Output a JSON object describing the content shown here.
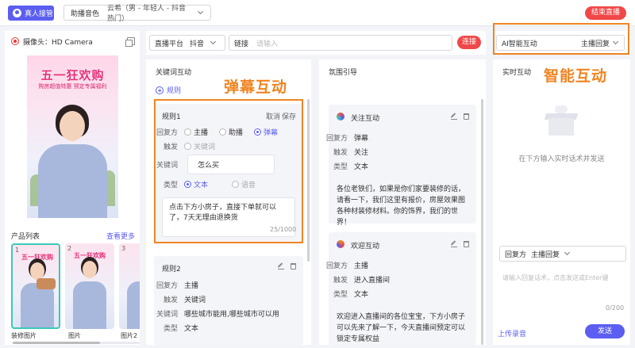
{
  "topbar": {
    "host_button": "真人接管",
    "voice_label": "助播音色",
    "voice_value": "云希（男 - 年轻人 - 抖音热门）",
    "end_button": "结束直播"
  },
  "left": {
    "camera_label": "摄像头：HD Camera",
    "video_banner": "五一狂欢购",
    "video_subbanner": "购房超值特惠 预定专属福利",
    "products_title": "产品列表",
    "products_more": "查看更多",
    "thumbs": [
      {
        "num": "1",
        "title": "五一狂欢购",
        "label": "装修图片"
      },
      {
        "num": "2",
        "title": "五一狂欢购",
        "label": "图片"
      },
      {
        "num": "3",
        "title": "五",
        "label": "图片2"
      }
    ]
  },
  "platform": {
    "label": "直播平台",
    "value": "抖音",
    "link_label": "链接",
    "link_placeholder": "请输入",
    "connect": "连接"
  },
  "keyword": {
    "title": "关键词互动",
    "add_rule": "规则",
    "overlay": "弹幕互动",
    "rule1": {
      "name": "规则1",
      "cancel": "取消",
      "save": "保存",
      "reply_label": "回复方",
      "opt1": "主播",
      "opt2": "助播",
      "opt3": "弹幕",
      "trigger_label": "触发",
      "trigger_value": "关键词",
      "kw_label": "关键词",
      "kw_value": "怎么买",
      "type_label": "类型",
      "type_text": "文本",
      "type_voice": "语音",
      "reply_text": "点击下方小房子，直接下单就可以了，7天无理由退换货",
      "counter": "25/1000"
    },
    "rule2": {
      "name": "规则2",
      "reply_label": "回复方",
      "reply_value": "主播",
      "trigger_label": "触发",
      "trigger_value": "关键词",
      "kw_label": "关键词",
      "kw_value": "哪些城市能用,哪些城市可以用",
      "type_label": "类型",
      "type_value": "文本"
    }
  },
  "atmos": {
    "title": "氛围引导",
    "card1": {
      "name": "关注互动",
      "reply_label": "回复方",
      "reply_value": "弹幕",
      "trigger_label": "触发",
      "trigger_value": "关注",
      "type_label": "类型",
      "type_value": "文本",
      "text": "各位老铁们，如果是你们家要装修的话，请看一下，我们这里有报价，房屋效果图各种材装修材料。你的饰界，我们的世界！"
    },
    "card2": {
      "name": "欢迎互动",
      "reply_label": "回复方",
      "reply_value": "主播",
      "trigger_label": "触发",
      "trigger_value": "进入直播间",
      "type_label": "类型",
      "type_value": "文本",
      "text": "欢迎进入直播间的各位宝宝，下方小房子可以先来了解一下，今天直播间预定可以锁定专属权益"
    }
  },
  "ai": {
    "label": "AI智能互动",
    "value": "主播回复",
    "overlay": "智能互动",
    "rt_title": "实时互动",
    "empty": "在下方输入实时话术并发送",
    "reply_label": "回复方",
    "reply_value": "主播回复",
    "input_placeholder": "请输入回复话术，点击发送或Enter键",
    "counter": "0/200",
    "upload": "上传录音",
    "send": "发送"
  },
  "colors": {
    "accent": "#5b5ef0",
    "danger": "#f04848",
    "highlight": "#f08422"
  }
}
